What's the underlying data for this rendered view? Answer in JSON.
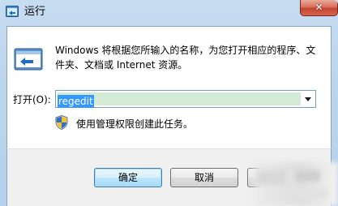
{
  "window": {
    "title": "运行",
    "close_glyph": "✕"
  },
  "description": "Windows 将根据您所输入的名称，为您打开相应的程序、文件夹、文档或 Internet 资源。",
  "open_field": {
    "label": "打开(O):",
    "value": "regedit"
  },
  "admin_note": "使用管理权限创建此任务。",
  "buttons": {
    "ok": "确定",
    "cancel": "取消"
  },
  "colors": {
    "selection": "#3399ff",
    "close_button": "#c44430"
  },
  "icons": [
    "run-app-icon",
    "run-program-icon",
    "uac-shield-icon",
    "dropdown-arrow-icon",
    "close-icon"
  ]
}
